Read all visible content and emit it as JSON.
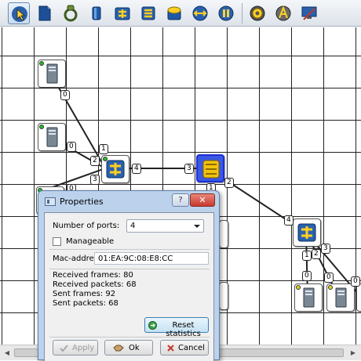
{
  "toolbar": {
    "items": [
      {
        "name": "select-tool",
        "icon": "pointer-icon",
        "selected": true
      },
      {
        "name": "document-tool",
        "icon": "document-icon"
      },
      {
        "name": "cable-tool",
        "icon": "cable-icon"
      },
      {
        "name": "device-tool",
        "icon": "cylinder-device-icon"
      },
      {
        "name": "hub-tool",
        "icon": "hub-icon"
      },
      {
        "name": "switch-tool",
        "icon": "switch-icon"
      },
      {
        "name": "router-tool",
        "icon": "router-icon"
      },
      {
        "name": "bridge-tool",
        "icon": "bridge-icon"
      },
      {
        "name": "pause-tool",
        "icon": "pause-icon"
      },
      {
        "name": "settings-tool",
        "icon": "gear-icon"
      },
      {
        "name": "font-tool",
        "icon": "font-icon"
      },
      {
        "name": "monitor-tool",
        "icon": "monitor-icon"
      }
    ]
  },
  "network": {
    "ports": {
      "p1": "0",
      "p2": "0",
      "p3": "1",
      "p4": "2",
      "p5": "3",
      "p6": "4",
      "p7": "3",
      "p8": "1",
      "p9": "2",
      "p10": "4",
      "p11": "1",
      "p12": "2",
      "p13": "3",
      "p14": "0",
      "p15": "0",
      "p16": "0",
      "p17": "0"
    }
  },
  "dialog": {
    "title": "Properties",
    "help_label": "?",
    "close_label": "✕",
    "ports_label": "Number of ports:",
    "ports_value": "4",
    "manageable_label": "Manageable",
    "manageable_checked": false,
    "mac_label": "Mac-address:",
    "mac_value": "01:EA:9C:08:E8:CC",
    "stats": {
      "received_frames": "Received frames: 80",
      "received_packets": "Received packets: 68",
      "sent_frames": "Sent frames: 92",
      "sent_packets": "Sent packets: 68"
    },
    "reset_label": "Reset statistics",
    "apply_label": "Apply",
    "ok_label": "Ok",
    "cancel_label": "Cancel"
  },
  "colors": {
    "selection_blue": "#3a58e0",
    "led_green": "#22c022",
    "led_yellow": "#e2d51a",
    "hub_yellow": "#f2c20f",
    "dialog_frame": "#bcd2ec",
    "close_red": "#c6392c"
  }
}
